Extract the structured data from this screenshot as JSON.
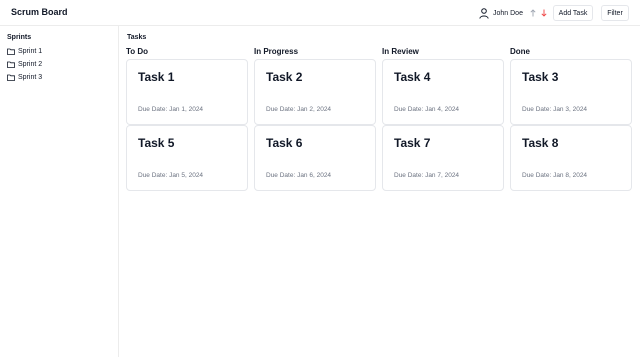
{
  "header": {
    "title": "Scrum Board",
    "user_name": "John Doe",
    "add_task_label": "Add Task",
    "filter_label": "Filter",
    "icons": [
      "user-icon",
      "arrow-up-icon",
      "arrow-down-icon"
    ],
    "arrow_up_color": "#9ca3af",
    "arrow_down_color": "#ef4444"
  },
  "sidebar": {
    "title": "Sprints",
    "items": [
      {
        "label": "Sprint 1",
        "icon": "folder-icon"
      },
      {
        "label": "Sprint 2",
        "icon": "folder-icon"
      },
      {
        "label": "Sprint 3",
        "icon": "folder-icon"
      }
    ]
  },
  "main": {
    "title": "Tasks",
    "columns": [
      {
        "title": "To Do",
        "cards": [
          {
            "title": "Task 1",
            "due": "Due Date: Jan 1, 2024"
          },
          {
            "title": "Task 5",
            "due": "Due Date: Jan 5, 2024"
          }
        ]
      },
      {
        "title": "In Progress",
        "cards": [
          {
            "title": "Task 2",
            "due": "Due Date: Jan 2, 2024"
          },
          {
            "title": "Task 6",
            "due": "Due Date: Jan 6, 2024"
          }
        ]
      },
      {
        "title": "In Review",
        "cards": [
          {
            "title": "Task 4",
            "due": "Due Date: Jan 4, 2024"
          },
          {
            "title": "Task 7",
            "due": "Due Date: Jan 7, 2024"
          }
        ]
      },
      {
        "title": "Done",
        "cards": [
          {
            "title": "Task 3",
            "due": "Due Date: Jan 3, 2024"
          },
          {
            "title": "Task 8",
            "due": "Due Date: Jan 8, 2024"
          }
        ]
      }
    ]
  }
}
